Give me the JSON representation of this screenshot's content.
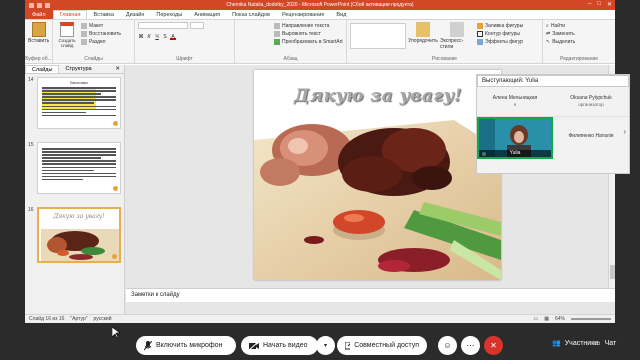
{
  "window": {
    "title": "Chernika Natalia_dodotky_2020 - Microsoft PowerPoint (Сбой активации продукта)",
    "quick_access": [
      "save-icon",
      "undo-icon",
      "redo-icon"
    ]
  },
  "ribbon_tabs": {
    "file": "Файл",
    "tabs": [
      "Главная",
      "Вставка",
      "Дизайн",
      "Переходы",
      "Анимация",
      "Показ слайдов",
      "Рецензирование",
      "Вид"
    ],
    "active": "Главная"
  },
  "ribbon": {
    "clipboard": {
      "paste": "Вставить",
      "group": "Буфер об..."
    },
    "slides": {
      "new_slide": "Создать слайд",
      "layout": "Макет",
      "reset": "Восстановить",
      "section": "Раздел",
      "group": "Слайды"
    },
    "font": {
      "group": "Шрифт"
    },
    "paragraph": {
      "text_direction": "Направление текста",
      "align_text": "Выровнять текст",
      "smartart": "Преобразовать в SmartArt",
      "group": "Абзац"
    },
    "drawing": {
      "arrange": "Упорядочить",
      "quick_styles": "Экспресс-стили",
      "shape_fill": "Заливка фигуры",
      "shape_outline": "Контур фигуры",
      "shape_effects": "Эффекты фигур",
      "group": "Рисование"
    },
    "editing": {
      "find": "Найти",
      "replace": "Заменить",
      "select": "Выделить",
      "group": "Редактирование"
    }
  },
  "panel": {
    "tabs": [
      "Слайды",
      "Структура"
    ],
    "active_tab": "Слайды",
    "thumbnails": [
      {
        "number": "14",
        "heading": "Висновки"
      },
      {
        "number": "15",
        "heading": ""
      },
      {
        "number": "16",
        "heading": "Дякую за увагу!"
      }
    ]
  },
  "slide": {
    "title": "Дякую за увагу!"
  },
  "notes": {
    "placeholder": "Заметки к слайду"
  },
  "statusbar": {
    "slide_info": "Слайд 16 из 16",
    "theme": "\"Артур\"",
    "language": "русский",
    "zoom": "64%"
  },
  "meeting": {
    "presenter_label": "Выступающий: Yulia",
    "participants": [
      {
        "name": "Алена Мельницкая",
        "role": "я"
      },
      {
        "name": "Oksana Pylypchuk",
        "role": "организатор"
      },
      {
        "name": "Yulia",
        "role": ""
      },
      {
        "name": "Филипенко Наталія",
        "role": ""
      }
    ],
    "controls": {
      "mic": "Включить микрофон",
      "video": "Начать видео",
      "share": "Совместный доступ",
      "participants": "Участники",
      "chat": "Чат"
    }
  },
  "colors": {
    "ppt_accent": "#d24726",
    "end_call": "#d9342b",
    "active_speaker": "#15a74a"
  }
}
